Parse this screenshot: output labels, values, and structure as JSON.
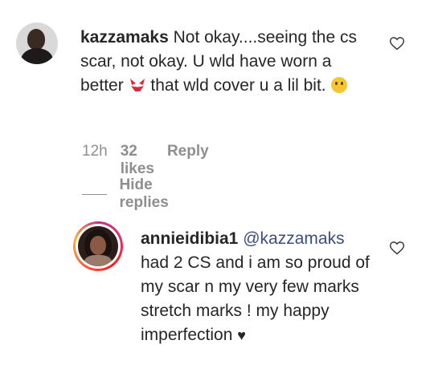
{
  "comment": {
    "username": "kazzamaks",
    "text_part1": "Not okay....seeing the cs scar, not okay. U wld have worn a better ",
    "text_part2": " that wld cover u a lil bit.",
    "emoji1_icon": "bikini-icon",
    "emoji2_icon": "crying-face-icon",
    "time": "12h",
    "likes": "32 likes",
    "reply_label": "Reply",
    "hide_replies_label": "Hide replies"
  },
  "reply": {
    "username": "annieidibia1",
    "mention": "@kazzamaks",
    "text": "had 2 CS and i am so proud of my scar n my very few marks stretch marks ! my happy imperfection ",
    "emoji_icon": "black-heart-icon"
  },
  "colors": {
    "text": "#262626",
    "meta": "#8e8e8e",
    "mention": "#3b4e80"
  }
}
